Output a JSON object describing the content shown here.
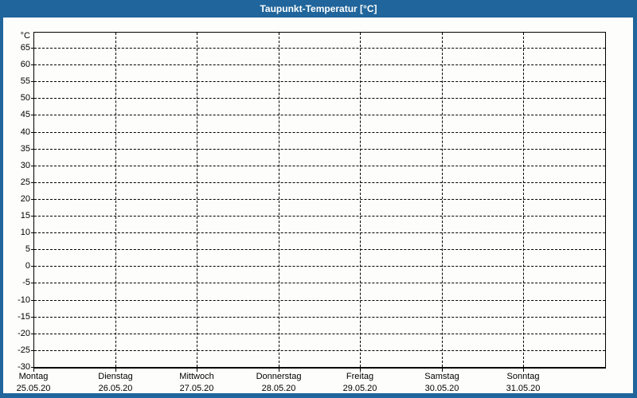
{
  "title_bar": {
    "title": "Taupunkt-Temperatur [°C]"
  },
  "colors": {
    "frame_blue": "#20659B",
    "title_text": "#FFFFFF",
    "plot_background": "#FDFEFB",
    "grid_and_axis": "#000000",
    "label_text": "#000000"
  },
  "chart_data": {
    "type": "line",
    "title": "Taupunkt-Temperatur [°C]",
    "xlabel": "",
    "ylabel": "°C",
    "ylim": [
      -30,
      70
    ],
    "y_tick_step": 5,
    "y_ticks": [
      65,
      60,
      55,
      50,
      45,
      40,
      35,
      30,
      25,
      20,
      15,
      10,
      5,
      0,
      -5,
      -10,
      -15,
      -20,
      -25,
      -30
    ],
    "x_categories": [
      {
        "day": "Montag",
        "date": "25.05.20"
      },
      {
        "day": "Dienstag",
        "date": "26.05.20"
      },
      {
        "day": "Mittwoch",
        "date": "27.05.20"
      },
      {
        "day": "Donnerstag",
        "date": "28.05.20"
      },
      {
        "day": "Freitag",
        "date": "29.05.20"
      },
      {
        "day": "Samstag",
        "date": "30.05.20"
      },
      {
        "day": "Sonntag",
        "date": "31.05.20"
      }
    ],
    "series": [],
    "grid": "dashed",
    "legend_position": "none"
  }
}
